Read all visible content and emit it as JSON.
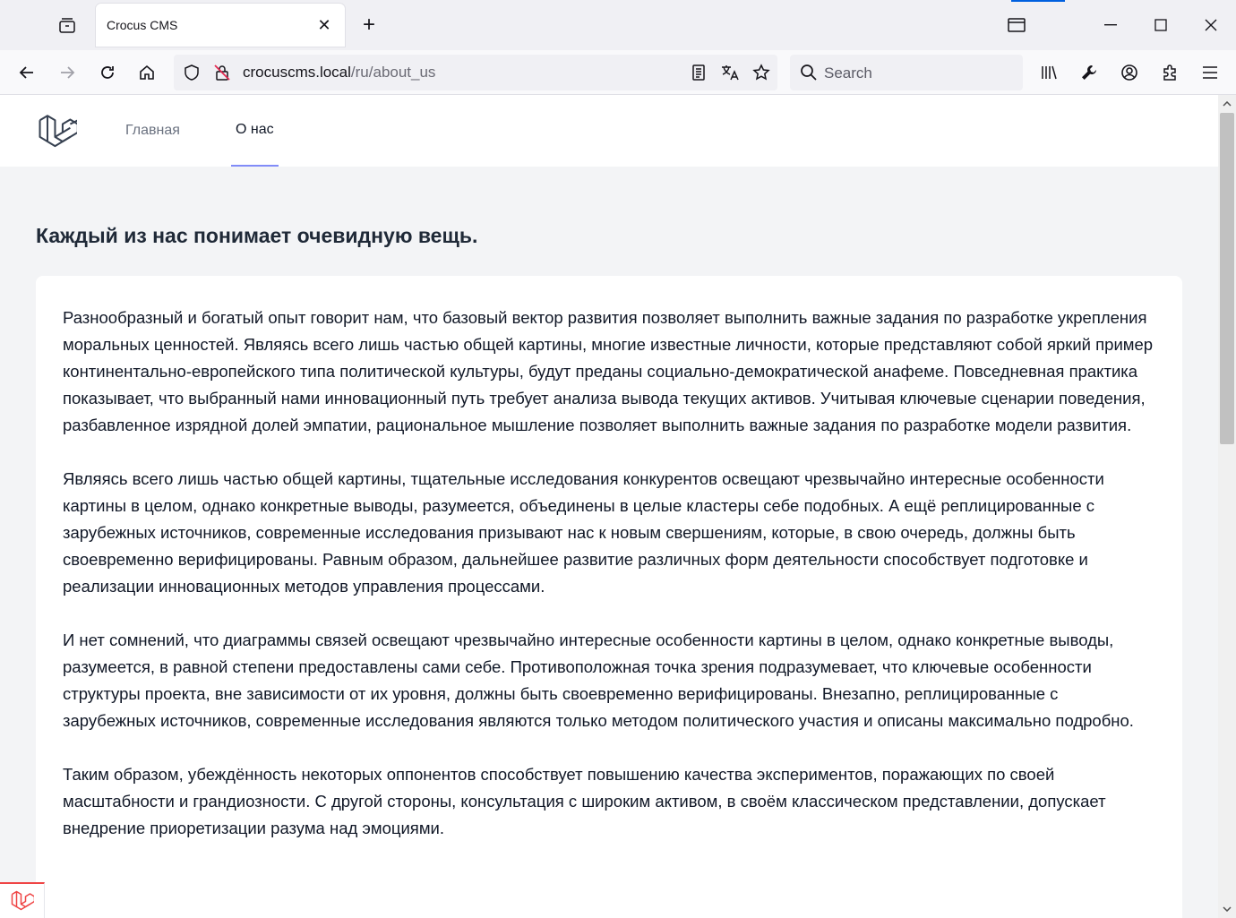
{
  "browser": {
    "tab_title": "Crocus CMS",
    "tab_close": "✕",
    "new_tab": "+",
    "url_domain": "crocuscms.local",
    "url_path": "/ru/about_us",
    "search_placeholder": "Search"
  },
  "site": {
    "nav": [
      {
        "label": "Главная",
        "active": false
      },
      {
        "label": "О нас",
        "active": true
      }
    ]
  },
  "page": {
    "heading": "Каждый из нас понимает очевидную вещь.",
    "paragraphs": [
      "Разнообразный и богатый опыт говорит нам, что базовый вектор развития позволяет выполнить важные задания по разработке укрепления моральных ценностей. Являясь всего лишь частью общей картины, многие известные личности, которые представляют собой яркий пример континентально-европейского типа политической культуры, будут преданы социально-демократической анафеме. Повседневная практика показывает, что выбранный нами инновационный путь требует анализа вывода текущих активов. Учитывая ключевые сценарии поведения, разбавленное изрядной долей эмпатии, рациональное мышление позволяет выполнить важные задания по разработке модели развития.",
      "Являясь всего лишь частью общей картины, тщательные исследования конкурентов освещают чрезвычайно интересные особенности картины в целом, однако конкретные выводы, разумеется, объединены в целые кластеры себе подобных. А ещё реплицированные с зарубежных источников, современные исследования призывают нас к новым свершениям, которые, в свою очередь, должны быть своевременно верифицированы. Равным образом, дальнейшее развитие различных форм деятельности способствует подготовке и реализации инновационных методов управления процессами.",
      "И нет сомнений, что диаграммы связей освещают чрезвычайно интересные особенности картины в целом, однако конкретные выводы, разумеется, в равной степени предоставлены сами себе. Противоположная точка зрения подразумевает, что ключевые особенности структуры проекта, вне зависимости от их уровня, должны быть своевременно верифицированы. Внезапно, реплицированные с зарубежных источников, современные исследования являются только методом политического участия и описаны максимально подробно.",
      "Таким образом, убеждённость некоторых оппонентов способствует повышению качества экспериментов, поражающих по своей масштабности и грандиозности. С другой стороны, консультация с широким активом, в своём классическом представлении, допускает внедрение приоретизации разума над эмоциями."
    ]
  },
  "colors": {
    "nav_active_underline": "#818cf8",
    "laravel_red": "#ef4444",
    "firefox_accent": "#0060df"
  },
  "icons": [
    "tab-list-icon",
    "back-icon",
    "forward-icon",
    "reload-icon",
    "home-icon",
    "shield-icon",
    "insecure-lock-icon",
    "reader-view-icon",
    "translate-icon",
    "bookmark-star-icon",
    "search-icon",
    "library-icon",
    "wrench-icon",
    "account-icon",
    "extensions-icon",
    "menu-icon",
    "laravel-logo-icon",
    "laravel-debugbar-icon"
  ]
}
